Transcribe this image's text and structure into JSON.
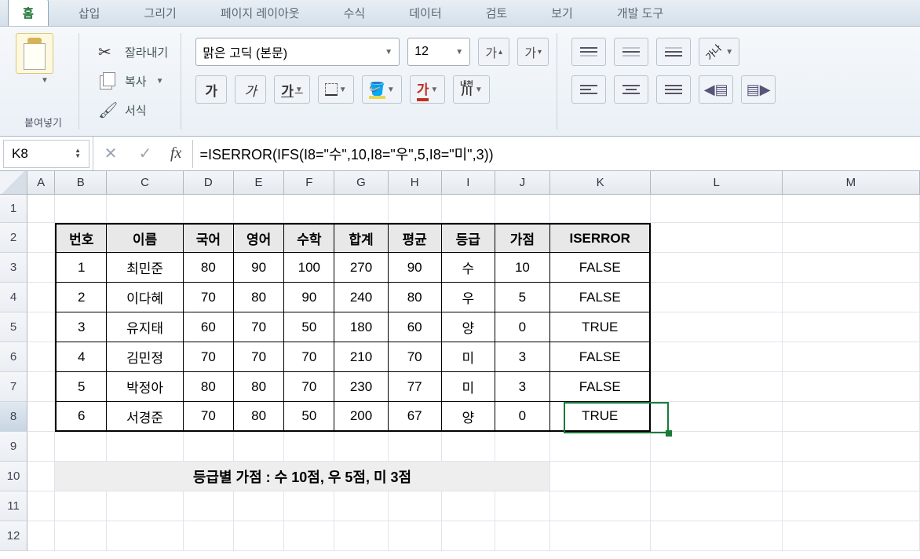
{
  "ribbon": {
    "tabs": [
      "홈",
      "삽입",
      "그리기",
      "페이지 레이아웃",
      "수식",
      "데이터",
      "검토",
      "보기",
      "개발 도구"
    ],
    "active_tab_index": 0,
    "paste_label": "붙여넣기",
    "cut_label": "잘라내기",
    "copy_label": "복사",
    "format_label": "서식",
    "font_name": "맑은 고딕 (본문)",
    "font_size": "12",
    "bold": "가",
    "italic": "가",
    "underline": "가",
    "font_size_up": "가",
    "font_size_down": "가",
    "highlight": "가",
    "ruby_top": "내천",
    "ruby_bot": "川",
    "wrap": "가나"
  },
  "formula_bar": {
    "cell_ref": "K8",
    "formula": "=ISERROR(IFS(I8=\"수\",10,I8=\"우\",5,I8=\"미\",3))"
  },
  "columns": [
    "A",
    "B",
    "C",
    "D",
    "E",
    "F",
    "G",
    "H",
    "I",
    "J",
    "K",
    "L",
    "M"
  ],
  "rows_shown": [
    1,
    2,
    3,
    4,
    5,
    6,
    7,
    8,
    9,
    10,
    11,
    12
  ],
  "table": {
    "headers": [
      "번호",
      "이름",
      "국어",
      "영어",
      "수학",
      "합계",
      "평균",
      "등급",
      "가점",
      "ISERROR"
    ],
    "rows": [
      [
        "1",
        "최민준",
        "80",
        "90",
        "100",
        "270",
        "90",
        "수",
        "10",
        "FALSE"
      ],
      [
        "2",
        "이다혜",
        "70",
        "80",
        "90",
        "240",
        "80",
        "우",
        "5",
        "FALSE"
      ],
      [
        "3",
        "유지태",
        "60",
        "70",
        "50",
        "180",
        "60",
        "양",
        "0",
        "TRUE"
      ],
      [
        "4",
        "김민정",
        "70",
        "70",
        "70",
        "210",
        "70",
        "미",
        "3",
        "FALSE"
      ],
      [
        "5",
        "박정아",
        "80",
        "80",
        "70",
        "230",
        "77",
        "미",
        "3",
        "FALSE"
      ],
      [
        "6",
        "서경준",
        "70",
        "80",
        "50",
        "200",
        "67",
        "양",
        "0",
        "TRUE"
      ]
    ],
    "note": "등급별 가점 : 수 10점, 우 5점, 미 3점"
  },
  "active_cell": "K8"
}
